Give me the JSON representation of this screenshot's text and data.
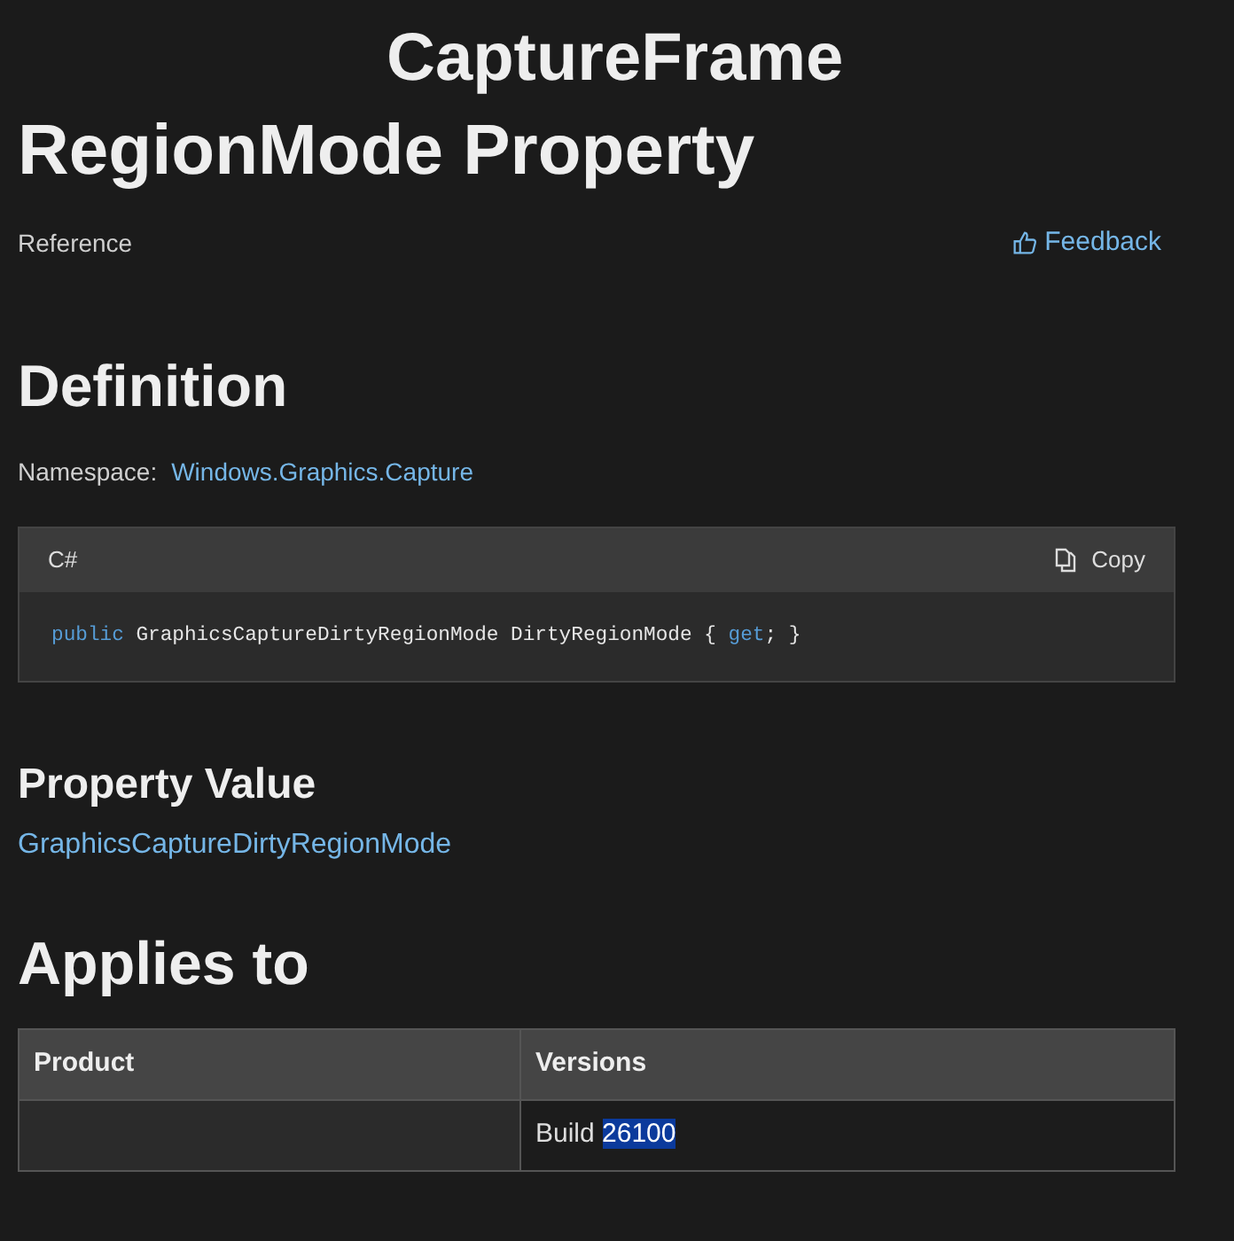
{
  "title": {
    "line_1": "CaptureFrame",
    "line_2": "RegionMode Property"
  },
  "subtitle": "Reference",
  "feedback_link": "Feedback",
  "definition": {
    "heading": "Definition",
    "namespace_label": "Namespace:",
    "namespace_link": "Windows.Graphics.Capture"
  },
  "code_block": {
    "language": "C#",
    "copy_label": "Copy",
    "tokens": [
      {
        "text": "public",
        "kind": "keyword"
      },
      {
        "text": " GraphicsCaptureDirtyRegionMode DirtyRegionMode { ",
        "kind": "plain"
      },
      {
        "text": "get",
        "kind": "keyword"
      },
      {
        "text": "; }",
        "kind": "plain"
      }
    ]
  },
  "property_value": {
    "heading": "Property Value",
    "type_link": "GraphicsCaptureDirtyRegionMode"
  },
  "applies_to": {
    "heading": "Applies to",
    "columns": [
      "Product",
      "Versions"
    ],
    "rows": [
      {
        "product": "",
        "versions": [
          {
            "text": "Build ",
            "highlighted": false
          },
          {
            "text": "26100",
            "highlighted": true
          }
        ]
      }
    ]
  }
}
